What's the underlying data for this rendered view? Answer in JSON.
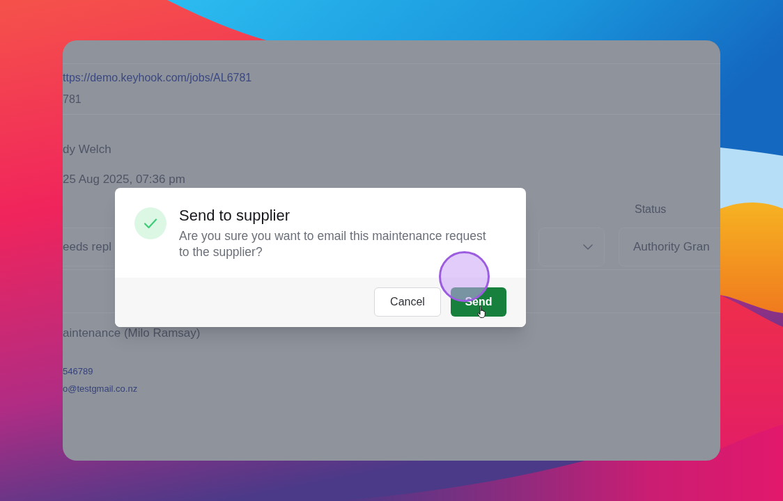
{
  "page": {
    "job_link": "ttps://demo.keyhook.com/jobs/AL6781",
    "job_id": "781",
    "person_name": "dy Welch",
    "created": "25 Aug 2025, 07:36 pm",
    "status_label": "Status",
    "description_field": {
      "value": "eeds repl"
    },
    "status_field": {
      "value": "Authority Gran"
    },
    "supplier": "aintenance (Milo Ramsay)",
    "phone": "546789",
    "email": "o@testgmail.co.nz"
  },
  "dialog": {
    "title": "Send to supplier",
    "message": "Are you sure you want to email this maintenance request to the supplier?",
    "buttons": [
      {
        "label": "Cancel",
        "kind": "secondary"
      },
      {
        "label": "Send",
        "kind": "primary"
      }
    ]
  }
}
